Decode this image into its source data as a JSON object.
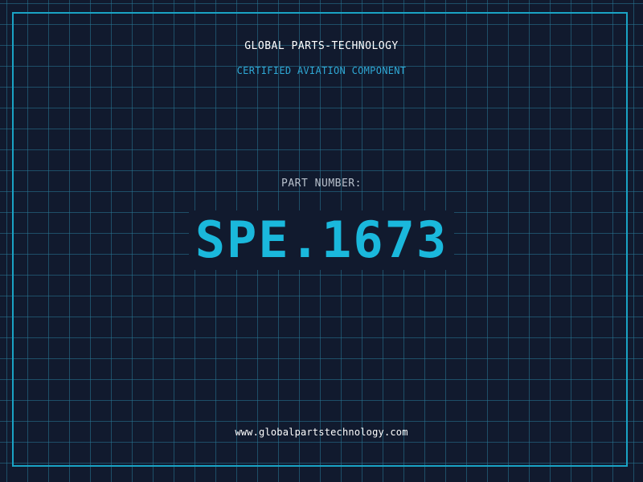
{
  "header": {
    "company": "GLOBAL PARTS-TECHNOLOGY",
    "subtitle": "CERTIFIED AVIATION COMPONENT"
  },
  "part": {
    "label": "PART NUMBER:",
    "number": "SPE.1673"
  },
  "footer": {
    "url": "www.globalpartstechnology.com"
  },
  "colors": {
    "background": "#111a2e",
    "grid": "#28788f",
    "frame": "#1aa3c4",
    "accent": "#1ab8dc",
    "subtitle": "#2fa9d6"
  }
}
